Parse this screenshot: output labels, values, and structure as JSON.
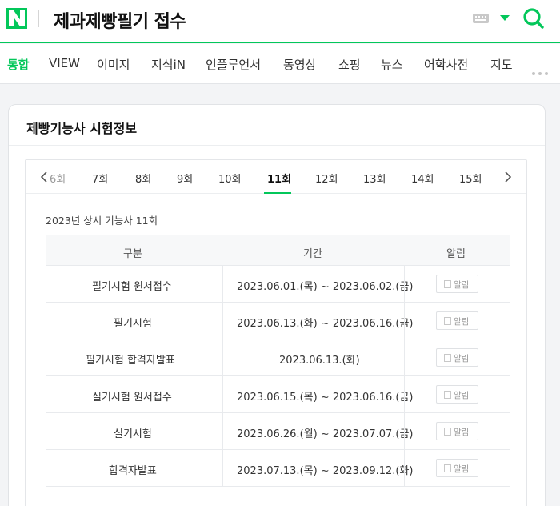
{
  "header": {
    "logo": "N",
    "query": "제과제빵필기 접수",
    "icons": [
      "keyboard-icon",
      "caret-down-icon",
      "search-icon"
    ],
    "accent": "#03c75a"
  },
  "tabs": [
    "통합",
    "VIEW",
    "이미지",
    "지식iN",
    "인플루언서",
    "동영상",
    "쇼핑",
    "뉴스",
    "어학사전",
    "지도"
  ],
  "card": {
    "title": "제빵기능사 시험정보",
    "rounds": [
      "6회",
      "7회",
      "8회",
      "9회",
      "10회",
      "11회",
      "12회",
      "13회",
      "14회",
      "15회"
    ],
    "selected_round": "11회",
    "subtitle": "2023년 상시 기능사 11회",
    "table": {
      "headers": [
        "구분",
        "기간",
        "알림"
      ],
      "rows": [
        {
          "category": "필기시험 원서접수",
          "period": "2023.06.01.(목) ~ 2023.06.02.(금)",
          "alarm": "알림"
        },
        {
          "category": "필기시험",
          "period": "2023.06.13.(화) ~ 2023.06.16.(금)",
          "alarm": "알림"
        },
        {
          "category": "필기시험 합격자발표",
          "period": "2023.06.13.(화)",
          "alarm": "알림"
        },
        {
          "category": "실기시험 원서접수",
          "period": "2023.06.15.(목) ~ 2023.06.16.(금)",
          "alarm": "알림"
        },
        {
          "category": "실기시험",
          "period": "2023.06.26.(월) ~ 2023.07.07.(금)",
          "alarm": "알림"
        },
        {
          "category": "합격자발표",
          "period": "2023.07.13.(목) ~ 2023.09.12.(화)",
          "alarm": "알림"
        }
      ]
    }
  }
}
